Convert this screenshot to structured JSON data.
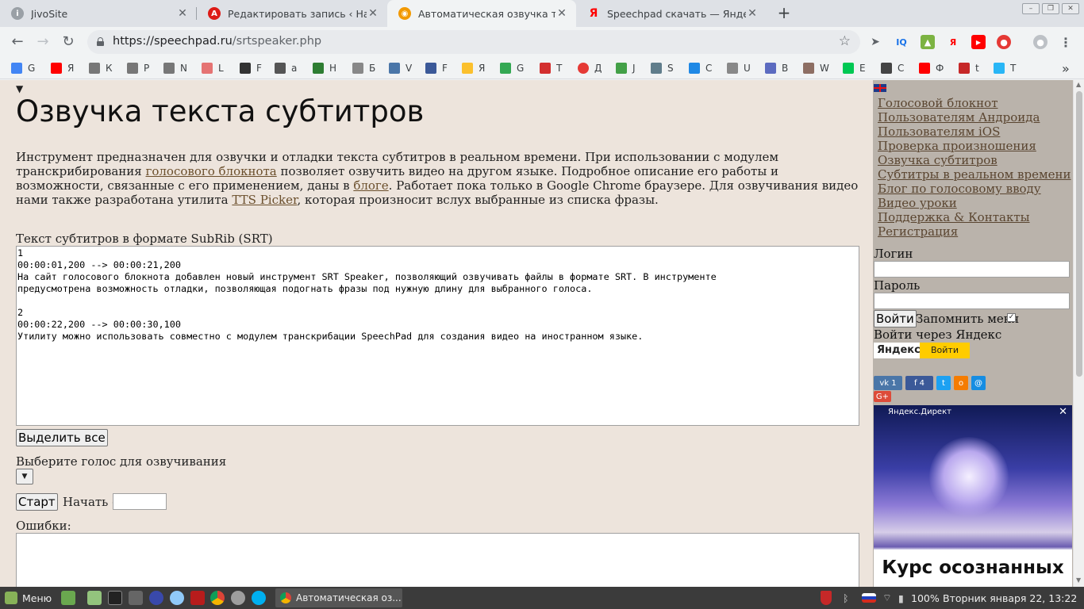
{
  "tabs": [
    {
      "title": "JivoSite",
      "icon": "jivosite-icon",
      "color": "#9aa0a6"
    },
    {
      "title": "Редактировать запись ‹ Наста",
      "icon": "angular-icon",
      "color": "#dd1b16"
    },
    {
      "title": "Автоматическая озвучка текс",
      "icon": "speechpad-icon",
      "color": "#f29900"
    },
    {
      "title": "Speechpad скачать — Яндекс",
      "icon": "yandex-icon",
      "color": "#ff0000"
    }
  ],
  "toolbar": {
    "url_host": "https://speechpad.ru",
    "url_path": "/srtspeaker.php"
  },
  "bookmarks": [
    {
      "label": "G",
      "color": "#4285f4"
    },
    {
      "label": "Я",
      "color": "#ff0000"
    },
    {
      "label": "К",
      "color": "#777777"
    },
    {
      "label": "Р",
      "color": "#777777"
    },
    {
      "label": "N",
      "color": "#777777"
    },
    {
      "label": "L",
      "color": "#e57373"
    },
    {
      "label": "F",
      "color": "#333333"
    },
    {
      "label": "a",
      "color": "#555555"
    },
    {
      "label": "Н",
      "color": "#2e7d32"
    },
    {
      "label": "Б",
      "color": "#888888"
    },
    {
      "label": "V",
      "color": "#4a76a8"
    },
    {
      "label": "F",
      "color": "#3b5998"
    },
    {
      "label": "Я",
      "color": "#fbc02d"
    },
    {
      "label": "G",
      "color": "#34a853"
    },
    {
      "label": "Т",
      "color": "#d32f2f"
    },
    {
      "label": "Д",
      "color": "#e53935"
    },
    {
      "label": "J",
      "color": "#43a047"
    },
    {
      "label": "S",
      "color": "#607d8b"
    },
    {
      "label": "С",
      "color": "#1e88e5"
    },
    {
      "label": "U",
      "color": "#888888"
    },
    {
      "label": "В",
      "color": "#5c6bc0"
    },
    {
      "label": "W",
      "color": "#8d6e63"
    },
    {
      "label": "Е",
      "color": "#00c853"
    },
    {
      "label": "С",
      "color": "#444444"
    },
    {
      "label": "Ф",
      "color": "#ff0000"
    },
    {
      "label": "t",
      "color": "#c62828"
    },
    {
      "label": "Т",
      "color": "#29b6f6"
    }
  ],
  "page": {
    "title": "Озвучка текста субтитров",
    "intro": {
      "p1": "Инструмент предназначен для озвучки и отладки текста субтитров в реальном времени. При использовании с модулем транскрибирования ",
      "link1": "голосового блокнота",
      "p2": " позволяет озвучить видео на другом языке. Подробное описание его работы и возможности, связанные с его применением, даны в ",
      "link2": "блоге",
      "p3": ". Работает пока только в Google Chrome браузере. Для озвучивания видео нами также разработана утилита ",
      "link3": "TTS Picker",
      "p4": ", которая произносит вслух выбранные из списка фразы."
    },
    "srt_label": "Текст субтитров в формате SubRib (SRT)",
    "srt_text": "1\n00:00:01,200 --> 00:00:21,200\nНа сайт голосового блокнота добавлен новый инструмент SRT Speaker, позволяющий озвучивать файлы в формате SRT. В инструменте\nпредусмотрена возможность отладки, позволяющая подогнать фразы под нужную длину для выбранного голоса.\n\n2\n00:00:22,200 --> 00:00:30,100\nУтилиту можно использовать совместно с модулем транскрибации SpeechPad для создания видео на иностранном языке.",
    "select_all": "Выделить все",
    "voice_label": "Выберите голос для озвучивания",
    "start": "Старт",
    "start_from": "Начать с",
    "errors_label": "Ошибки:"
  },
  "sidebar": {
    "menu": [
      "Голосовой блокнот",
      "Пользователям Андроида",
      "Пользователям iOS",
      "Проверка произношения",
      "Озвучка субтитров",
      "Субтитры в реальном времени",
      "Блог по голосовому вводу",
      "Видео уроки",
      "Поддержка & Контакты",
      "Регистрация"
    ],
    "login_label": "Логин",
    "password_label": "Пароль",
    "login_button": "Войти",
    "remember": "Запомнить меня",
    "yandex_login": "Войти через Яндекс",
    "yandex_logo": "Яндекс",
    "yandex_go": "Войти",
    "share": {
      "vk_count": "1",
      "fb_count": "4",
      "gplus": "G+"
    },
    "ad": {
      "label": "Яндекс.Директ",
      "title": "Курс осознанных"
    }
  },
  "taskbar": {
    "menu": "Меню",
    "window": "Автоматическая оз...",
    "battery": "100%",
    "clock": "Вторник января 22, 13:22"
  }
}
